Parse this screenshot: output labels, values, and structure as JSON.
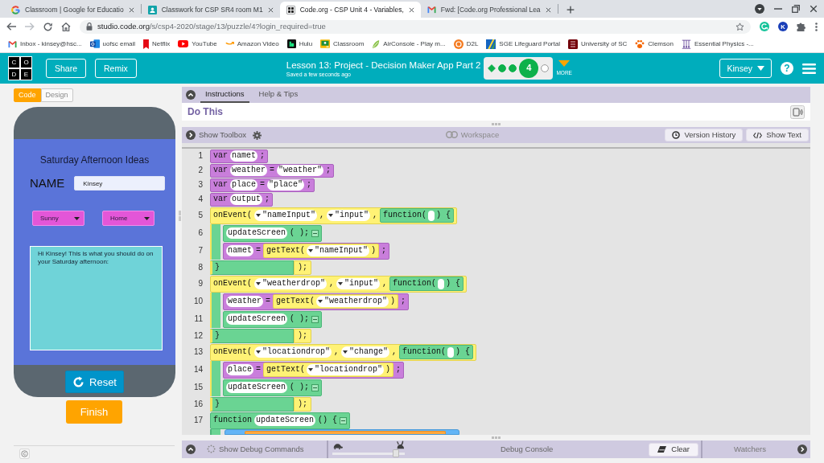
{
  "browser": {
    "tabs": [
      {
        "kind": "g_logo",
        "title": "Classroom | Google for Educatio",
        "selected": false
      },
      {
        "kind": "person",
        "title": "Classwork for CSP SR4 room M1",
        "selected": false
      },
      {
        "kind": "grid",
        "title": "Code.org - CSP Unit 4 - Variables,",
        "selected": true
      },
      {
        "kind": "mail",
        "title": "Fwd: [Code.org Professional Lea",
        "selected": false
      }
    ],
    "url": {
      "host": "studio.code.org",
      "path": "/s/csp4-2020/stage/13/puzzle/4?login_required=true"
    },
    "account": "K",
    "bookmarks": [
      {
        "kind": "mail",
        "label": "Inbox - kinsey@hsc..."
      },
      {
        "kind": "outlook",
        "label": "uofsc email"
      },
      {
        "kind": "ribbon",
        "label": "Netflix"
      },
      {
        "kind": "play",
        "label": "YouTube"
      },
      {
        "kind": "smile",
        "label": "Amazon Video"
      },
      {
        "kind": "dark_tile",
        "label": "Hulu"
      },
      {
        "kind": "board",
        "label": "Classroom"
      },
      {
        "kind": "leaf",
        "label": "AirConsole - Play m..."
      },
      {
        "kind": "disc",
        "label": "D2L"
      },
      {
        "kind": "stripes",
        "label": "SGE Lifeguard Portal"
      },
      {
        "kind": "crest",
        "label": "University of SC"
      },
      {
        "kind": "paw",
        "label": "Clemson"
      },
      {
        "kind": "pendulum",
        "label": "Essential Physics -..."
      }
    ]
  },
  "header": {
    "logo": [
      "C",
      "O",
      "D",
      "E"
    ],
    "buttons": [
      "Share",
      "Remix"
    ],
    "title": "Lesson 13: Project - Decision Maker App Part 2",
    "subtitle": "Saved a few seconds ago",
    "progress": [
      {
        "kind": "diamond",
        "completed": true,
        "selected": false
      },
      {
        "kind": "dot",
        "completed": true,
        "selected": false
      },
      {
        "kind": "dot",
        "completed": true,
        "selected": false
      },
      {
        "kind": "dot",
        "completed": true,
        "selected": true,
        "label": "4"
      },
      {
        "kind": "dot",
        "completed": false,
        "selected": false
      }
    ],
    "more": "MORE",
    "user": "Kinsey",
    "help": "?"
  },
  "app": {
    "modes": [
      {
        "label": "Code",
        "selected": true
      },
      {
        "label": "Design",
        "selected": false
      }
    ],
    "title": "Saturday Afternoon Ideas",
    "name_label": "NAME",
    "name_value": "Kinsey",
    "dropdowns": [
      "Sunny",
      "Home"
    ],
    "output": "Hi Kinsey! This is what you should do on your Saturday afternoon:",
    "reset": "Reset",
    "finish": "Finish"
  },
  "instructions": {
    "tabs": [
      {
        "label": "Instructions",
        "selected": true
      },
      {
        "label": "Help & Tips",
        "selected": false
      }
    ],
    "heading": "Do This"
  },
  "workspace": {
    "toolbox": "Show Toolbox",
    "title": "Workspace",
    "buttons": [
      {
        "kind": "history",
        "label": "Version History"
      },
      {
        "kind": "code",
        "label": "Show Text"
      }
    ]
  },
  "code": [
    {
      "kind": "variable",
      "line": "1",
      "parts": [
        {
          "kind": "text",
          "text": "var"
        },
        {
          "kind": "field",
          "text": "namet"
        },
        {
          "kind": "text",
          "text": ";"
        }
      ]
    },
    {
      "kind": "variable",
      "line": "2",
      "parts": [
        {
          "kind": "text",
          "text": "var"
        },
        {
          "kind": "field",
          "text": "weather"
        },
        {
          "kind": "text",
          "text": "="
        },
        {
          "kind": "field",
          "text": "\"weather\""
        },
        {
          "kind": "text",
          "text": ";"
        }
      ]
    },
    {
      "kind": "variable",
      "line": "3",
      "parts": [
        {
          "kind": "text",
          "text": "var"
        },
        {
          "kind": "field",
          "text": "place"
        },
        {
          "kind": "text",
          "text": "="
        },
        {
          "kind": "field",
          "text": "\"place\""
        },
        {
          "kind": "text",
          "text": ";"
        }
      ]
    },
    {
      "kind": "variable",
      "line": "4",
      "parts": [
        {
          "kind": "text",
          "text": "var"
        },
        {
          "kind": "field",
          "text": "output"
        },
        {
          "kind": "text",
          "text": ";"
        }
      ]
    },
    {
      "kind": "event",
      "line": "5",
      "parts": [
        {
          "kind": "text",
          "text": "onEvent("
        },
        {
          "kind": "dropdown",
          "text": "\"nameInput\""
        },
        {
          "kind": "text",
          "text": ","
        },
        {
          "kind": "dropdown",
          "text": "\"input\""
        },
        {
          "kind": "text",
          "text": ","
        },
        {
          "kind": "function_block",
          "parts": [
            {
              "kind": "text",
              "text": "function("
            },
            {
              "kind": "slot"
            },
            {
              "kind": "text",
              "text": ") {"
            }
          ]
        }
      ],
      "children": [
        {
          "kind": "call",
          "line": "6",
          "parts": [
            {
              "kind": "field",
              "text": "updateScreen"
            },
            {
              "kind": "text",
              "text": "( );"
            },
            {
              "kind": "toggle"
            }
          ]
        },
        {
          "kind": "variable",
          "line": "7",
          "parts": [
            {
              "kind": "field",
              "text": "namet"
            },
            {
              "kind": "text",
              "text": "="
            },
            {
              "kind": "ui_block",
              "parts": [
                {
                  "kind": "text",
                  "text": "getText("
                },
                {
                  "kind": "dropdown",
                  "text": "\"nameInput\""
                },
                {
                  "kind": "text",
                  "text": ")"
                }
              ]
            },
            {
              "kind": "text",
              "text": ";"
            }
          ]
        }
      ],
      "end": {
        "line": "8",
        "brace": "}",
        "close": ");"
      }
    },
    {
      "kind": "event",
      "line": "9",
      "parts": [
        {
          "kind": "text",
          "text": "onEvent("
        },
        {
          "kind": "dropdown",
          "text": "\"weatherdrop\""
        },
        {
          "kind": "text",
          "text": ","
        },
        {
          "kind": "dropdown",
          "text": "\"input\""
        },
        {
          "kind": "text",
          "text": ","
        },
        {
          "kind": "function_block",
          "parts": [
            {
              "kind": "text",
              "text": "function("
            },
            {
              "kind": "slot"
            },
            {
              "kind": "text",
              "text": ") {"
            }
          ]
        }
      ],
      "children": [
        {
          "kind": "variable",
          "line": "10",
          "parts": [
            {
              "kind": "field",
              "text": "weather"
            },
            {
              "kind": "text",
              "text": "="
            },
            {
              "kind": "ui_block",
              "parts": [
                {
                  "kind": "text",
                  "text": "getText("
                },
                {
                  "kind": "dropdown",
                  "text": "\"weatherdrop\""
                },
                {
                  "kind": "text",
                  "text": ")"
                }
              ]
            },
            {
              "kind": "text",
              "text": ";"
            }
          ]
        },
        {
          "kind": "call",
          "line": "11",
          "parts": [
            {
              "kind": "field",
              "text": "updateScreen"
            },
            {
              "kind": "text",
              "text": "( );"
            },
            {
              "kind": "toggle"
            }
          ]
        }
      ],
      "end": {
        "line": "12",
        "brace": "}",
        "close": ");"
      }
    },
    {
      "kind": "event",
      "line": "13",
      "parts": [
        {
          "kind": "text",
          "text": "onEvent("
        },
        {
          "kind": "dropdown",
          "text": "\"locationdrop\""
        },
        {
          "kind": "text",
          "text": ","
        },
        {
          "kind": "dropdown",
          "text": "\"change\""
        },
        {
          "kind": "text",
          "text": ","
        },
        {
          "kind": "function_block",
          "parts": [
            {
              "kind": "text",
              "text": "function("
            },
            {
              "kind": "slot"
            },
            {
              "kind": "text",
              "text": ") {"
            }
          ]
        }
      ],
      "children": [
        {
          "kind": "variable",
          "line": "14",
          "parts": [
            {
              "kind": "field",
              "text": "place"
            },
            {
              "kind": "text",
              "text": "="
            },
            {
              "kind": "ui_block",
              "parts": [
                {
                  "kind": "text",
                  "text": "getText("
                },
                {
                  "kind": "dropdown",
                  "text": "\"locationdrop\""
                },
                {
                  "kind": "text",
                  "text": ")"
                }
              ]
            },
            {
              "kind": "text",
              "text": ";"
            }
          ]
        },
        {
          "kind": "call",
          "line": "15",
          "parts": [
            {
              "kind": "field",
              "text": "updateScreen"
            },
            {
              "kind": "text",
              "text": "( );"
            },
            {
              "kind": "toggle"
            }
          ]
        }
      ],
      "end": {
        "line": "16",
        "brace": "}",
        "close": ");"
      }
    },
    {
      "kind": "function",
      "line": "17",
      "parts": [
        {
          "kind": "text",
          "text": "function"
        },
        {
          "kind": "field",
          "text": "updateScreen"
        },
        {
          "kind": "text",
          "text": "() {"
        },
        {
          "kind": "toggle"
        }
      ],
      "children": [
        {
          "kind": "control",
          "parts": [
            {
              "kind": "value_block"
            }
          ]
        }
      ]
    }
  ],
  "debug": {
    "commands": "Show Debug Commands",
    "speed": {
      "level": 0.92
    },
    "console": "Debug Console",
    "clear": "Clear",
    "watchers": "Watchers"
  }
}
